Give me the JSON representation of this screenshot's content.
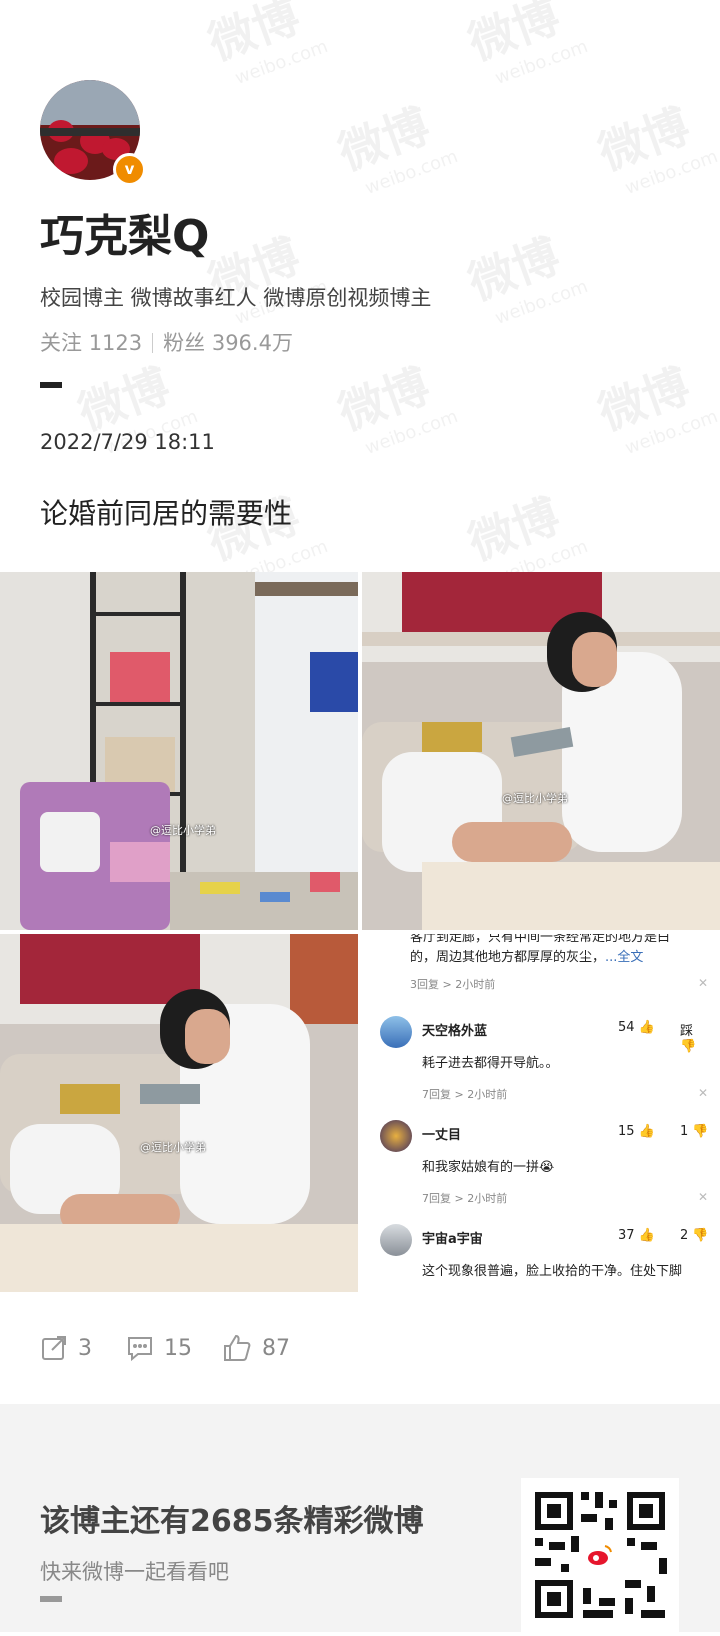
{
  "profile": {
    "username": "巧克梨Q",
    "tags": "校园博主 微博故事红人 微博原创视频博主",
    "following_label": "关注",
    "following_count": "1123",
    "followers_label": "粉丝",
    "followers_count": "396.4万",
    "verified_icon": "verified-badge-icon"
  },
  "post": {
    "date": "2022/7/29 18:11",
    "text": "论婚前同居的需要性",
    "image_tag": "@逗比小学弟",
    "reposts": "3",
    "comments": "15",
    "likes": "87"
  },
  "comment_screenshot": {
    "top_text_line1": "客厅到走廊，只有中间一条经常走的地方是白",
    "top_text_line2": "的，周边其他地方都厚厚的灰尘，",
    "top_full": "...全文",
    "top_meta": "3回复 >     2小时前",
    "comments": [
      {
        "name": "天空格外蓝",
        "text": "耗子进去都得开导航。。",
        "meta": "7回复 >     2小时前",
        "likes": "54",
        "dislike": "踩"
      },
      {
        "name": "一丈目",
        "text": "和我家姑娘有的一拼😭",
        "meta": "7回复 >     2小时前",
        "likes": "15",
        "dislike": "1"
      },
      {
        "name": "宇宙a宇宙",
        "text": "这个现象很普遍，脸上收拾的干净。住处下脚",
        "meta": "",
        "likes": "37",
        "dislike": "2"
      }
    ]
  },
  "footer": {
    "title": "该博主还有2685条精彩微博",
    "subtitle": "快来微博一起看看吧"
  },
  "watermark": {
    "main": "微博",
    "sub": "weibo.com"
  },
  "colors": {
    "badge": "#f08c00",
    "footer_bg": "#f3f3f3"
  }
}
